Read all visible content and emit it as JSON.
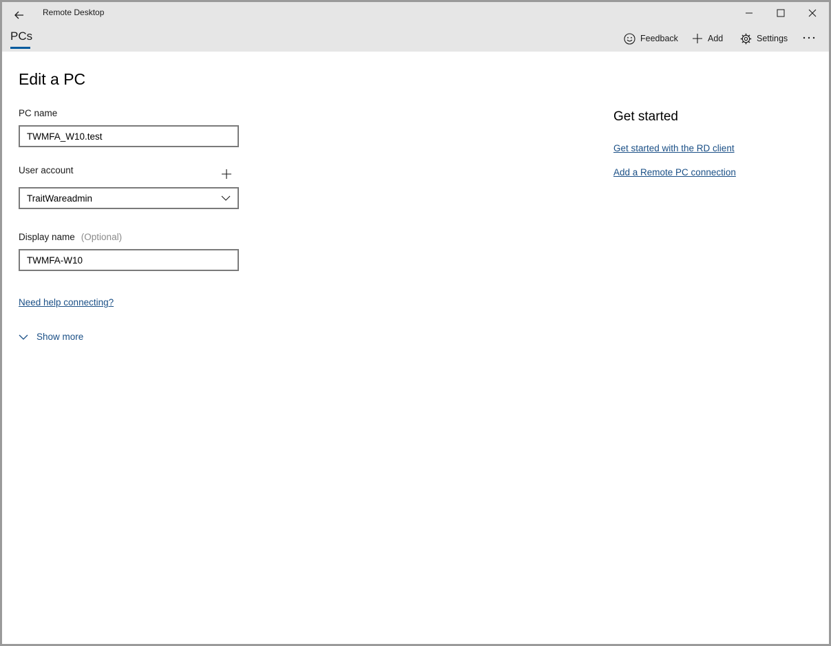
{
  "window": {
    "title": "Remote Desktop"
  },
  "nav": {
    "tab_label": "PCs",
    "feedback_label": "Feedback",
    "add_label": "Add",
    "settings_label": "Settings"
  },
  "form": {
    "heading": "Edit a PC",
    "pc_name_label": "PC name",
    "pc_name_value": "TWMFA_W10.test",
    "user_account_label": "User account",
    "user_account_value": "TraitWareadmin",
    "display_name_label": "Display name",
    "display_name_optional": "(Optional)",
    "display_name_value": "TWMFA-W10",
    "help_link": "Need help connecting?",
    "show_more_label": "Show more"
  },
  "side": {
    "heading": "Get started",
    "links": [
      "Get started with the RD client",
      "Add a Remote PC connection"
    ]
  },
  "colors": {
    "accent": "#005a9e",
    "link": "#1a4f86",
    "titlebar": "#e6e6e6"
  }
}
